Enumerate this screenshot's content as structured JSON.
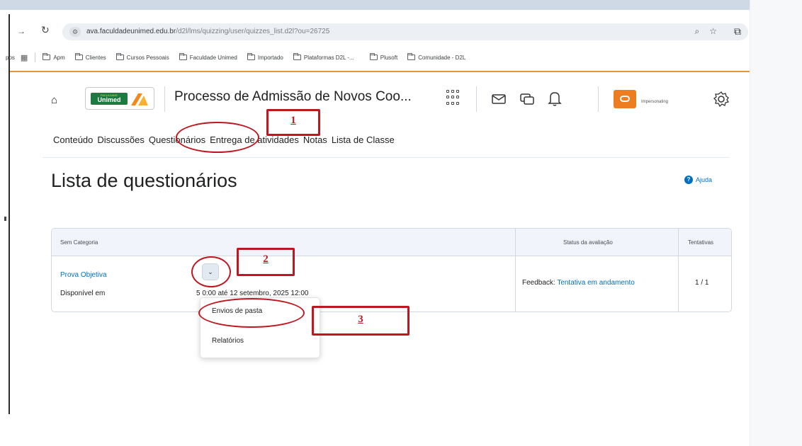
{
  "browser": {
    "url_host": "ava.faculdadeunimed.edu.br",
    "url_path": "/d2l/lms/quizzing/user/quizzes_list.d2l?ou=26725",
    "bookmarks_apps": "pps",
    "bookmarks": [
      "Apm",
      "Clientes",
      "Cursos Pessoais",
      "Faculdade Unimed",
      "Importado",
      "Plataformas D2L -...",
      "Plusoft",
      "Comunidade - D2L"
    ]
  },
  "header": {
    "logo_small": "FACULDADE",
    "logo_text": "Unimed",
    "course_title": "Processo de Admissão de Novos Coo...",
    "impersonating": "Impersonating"
  },
  "course_nav": [
    "Conteúdo",
    "Discussões",
    "Questionários",
    "Entrega de atividades",
    "Notas",
    "Lista de Classe"
  ],
  "page": {
    "title": "Lista de questionários",
    "help": "Ajuda"
  },
  "table": {
    "col_category": "Sem Categoria",
    "col_status": "Status da avaliação",
    "col_attempts": "Tentativas",
    "quiz_name": "Prova Objetiva",
    "available_label": "Disponível em",
    "available_dates": "5 0:00 até 12 setembro, 2025 12:00",
    "feedback_label": "Feedback:",
    "feedback_value": "Tentativa em andamento",
    "attempts_value": "1 / 1"
  },
  "context_menu": {
    "item1": "Envios de pasta",
    "item2": "Relatórios"
  },
  "annotations": {
    "step1": "1",
    "step2": "2",
    "step3": "3"
  },
  "colors": {
    "accent": "#006fbf",
    "annotation": "#c0161f",
    "brand_orange": "#ee7d1f",
    "brand_green": "#1d7a40"
  }
}
